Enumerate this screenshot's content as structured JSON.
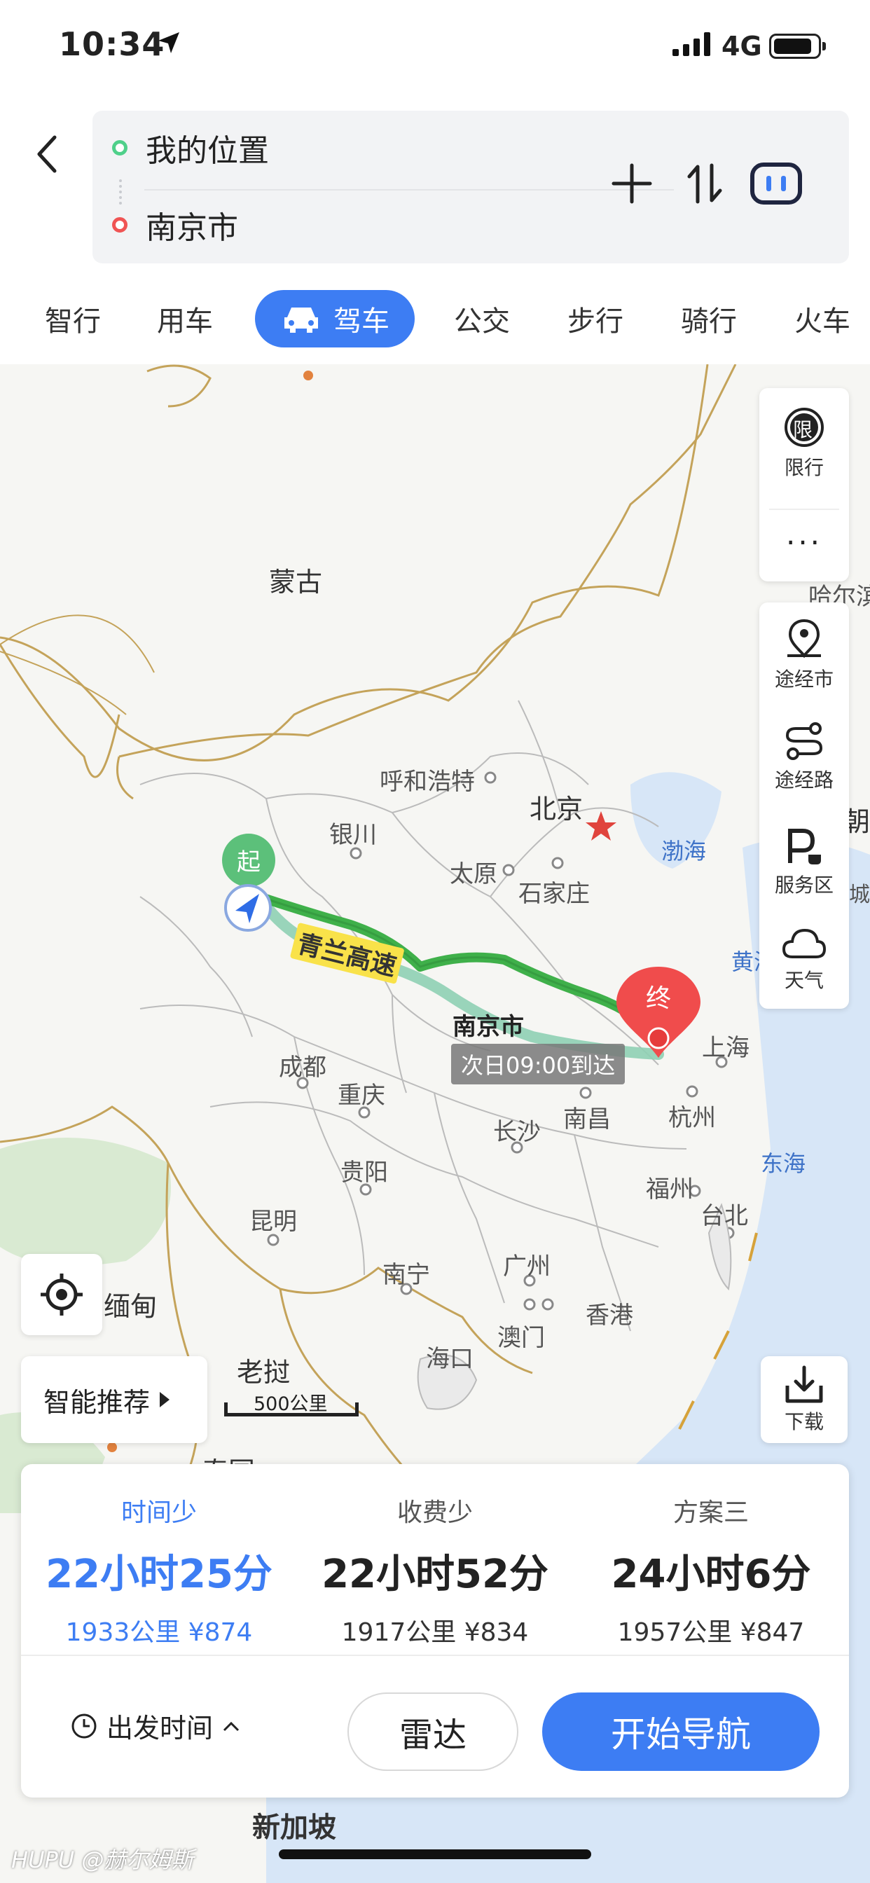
{
  "status": {
    "time": "10:34",
    "network": "4G",
    "battery_fraction": 0.88
  },
  "route": {
    "from": "我的位置",
    "to": "南京市"
  },
  "tabs": [
    "智行",
    "用车",
    "驾车",
    "公交",
    "步行",
    "骑行",
    "火车"
  ],
  "active_tab": "驾车",
  "side_panel": {
    "restrict": "限行",
    "restrict_badge": "限",
    "more": "···",
    "via_city": "途经市",
    "via_road": "途经路",
    "service": "服务区",
    "weather": "天气"
  },
  "map": {
    "labels": {
      "mongolia": "蒙古",
      "hohhot": "呼和浩特",
      "beijing": "北京",
      "yinchuan": "银川",
      "taiyuan": "太原",
      "shijiazhuang": "石家庄",
      "bohai": "渤海",
      "yellow_sea": "黄海",
      "harbin": "哈尔滨",
      "korea": "朝鲜",
      "nanjing": "南京市",
      "shanghai": "上海",
      "hangzhou": "杭州",
      "chengdu": "成都",
      "chongqing": "重庆",
      "changsha": "长沙",
      "nanchang": "南昌",
      "guiyang": "贵阳",
      "kunming": "昆明",
      "fuzhou": "福州",
      "taipei": "台北",
      "east_sea": "东海",
      "nanning": "南宁",
      "guangzhou": "广州",
      "hongkong": "香港",
      "macau": "澳门",
      "haikou": "海口",
      "myanmar": "缅甸",
      "laos": "老挝",
      "thailand": "泰国",
      "cheng": "城",
      "singapore": "新加坡"
    },
    "start_marker": "起",
    "end_marker": "终",
    "route_name": "青兰高速",
    "arrival": "次日09:00到达",
    "scale": "500公里"
  },
  "buttons": {
    "smart": "智能推荐",
    "download": "下载"
  },
  "plans": [
    {
      "title": "时间少",
      "duration": "22小时25分",
      "meta": "1933公里 ¥874"
    },
    {
      "title": "收费少",
      "duration": "22小时52分",
      "meta": "1917公里 ¥834"
    },
    {
      "title": "方案三",
      "duration": "24小时6分",
      "meta": "1957公里 ¥847"
    }
  ],
  "actions": {
    "depart": "出发时间",
    "radar": "雷达",
    "navigate": "开始导航"
  },
  "watermark": "HUPU @赫尔姆斯",
  "colors": {
    "accent": "#3d7df3",
    "route_main": "#3fb04a",
    "route_alt": "#8fd0b4",
    "end": "#f04c4c",
    "start": "#5cc07a"
  }
}
